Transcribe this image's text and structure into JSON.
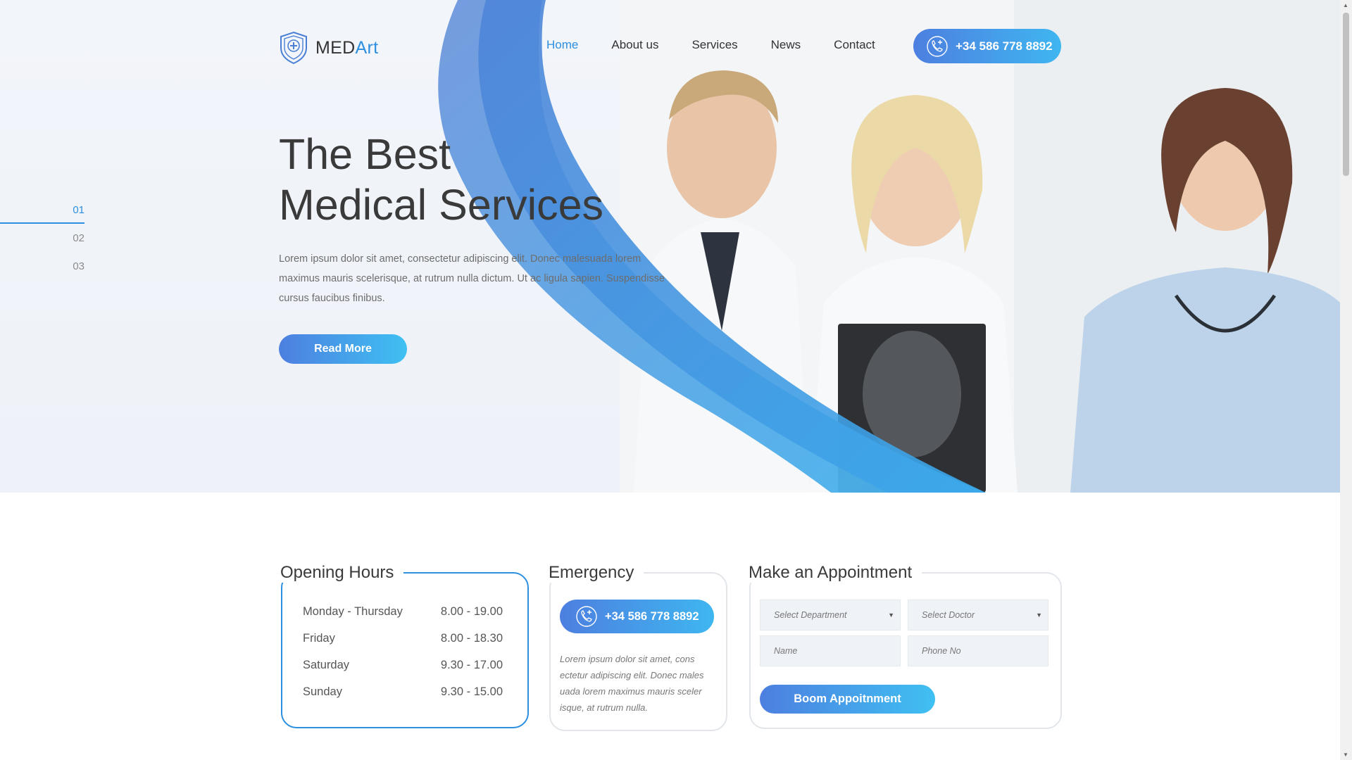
{
  "brand": {
    "name_part1": "MED",
    "name_part2": "Art"
  },
  "nav": {
    "items": [
      {
        "label": "Home",
        "active": true
      },
      {
        "label": "About us",
        "active": false
      },
      {
        "label": "Services",
        "active": false
      },
      {
        "label": "News",
        "active": false
      },
      {
        "label": "Contact",
        "active": false
      }
    ]
  },
  "header": {
    "phone": "+34 586 778 8892"
  },
  "slider": {
    "indicators": [
      "01",
      "02",
      "03"
    ],
    "active_index": 0
  },
  "hero": {
    "title_line1": "The Best",
    "title_line2": "Medical Services",
    "text": "Lorem ipsum dolor sit amet, consectetur adipiscing elit. Donec malesuada lorem maximus mauris scelerisque, at rutrum nulla dictum. Ut ac ligula sapien. Suspendisse cursus faucibus finibus.",
    "button": "Read More"
  },
  "opening_hours": {
    "title": "Opening Hours",
    "rows": [
      {
        "day": "Monday - Thursday",
        "time": "8.00 - 19.00"
      },
      {
        "day": "Friday",
        "time": "8.00 - 18.30"
      },
      {
        "day": "Saturday",
        "time": "9.30 - 17.00"
      },
      {
        "day": "Sunday",
        "time": "9.30 - 15.00"
      }
    ]
  },
  "emergency": {
    "title": "Emergency",
    "phone": "+34 586 778 8892",
    "text": "Lorem ipsum dolor sit amet, cons ectetur adipiscing elit. Donec males uada lorem maximus mauris sceler isque, at rutrum nulla."
  },
  "appointment": {
    "title": "Make an Appointment",
    "department_placeholder": "Select Department",
    "doctor_placeholder": "Select Doctor",
    "name_placeholder": "Name",
    "phone_placeholder": "Phone No",
    "button": "Boom Appoitnment"
  },
  "colors": {
    "accent": "#2d8fe0",
    "gradient_start": "#4d7fe0",
    "gradient_end": "#3fc0f2"
  }
}
